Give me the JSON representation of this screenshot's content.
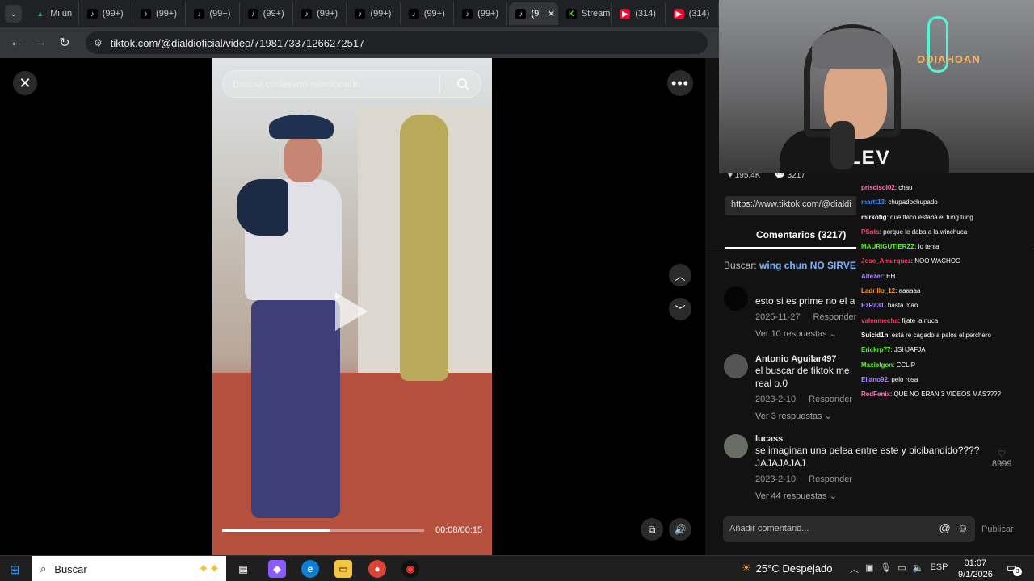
{
  "browser": {
    "tabs": [
      {
        "label": "Mi un",
        "icon": "drive-icon"
      },
      {
        "label": "(99+)",
        "icon": "tiktok-icon"
      },
      {
        "label": "(99+)",
        "icon": "tiktok-icon"
      },
      {
        "label": "(99+)",
        "icon": "tiktok-icon"
      },
      {
        "label": "(99+)",
        "icon": "tiktok-icon"
      },
      {
        "label": "(99+)",
        "icon": "tiktok-icon"
      },
      {
        "label": "(99+)",
        "icon": "tiktok-icon"
      },
      {
        "label": "(99+)",
        "icon": "tiktok-icon"
      },
      {
        "label": "(99+)",
        "icon": "tiktok-icon"
      },
      {
        "label": "(9",
        "icon": "tiktok-icon",
        "active": true
      },
      {
        "label": "Stream",
        "icon": "kick-icon"
      },
      {
        "label": "(314)",
        "icon": "youtube-icon"
      },
      {
        "label": "(314)",
        "icon": "youtube-icon"
      }
    ],
    "url": "tiktok.com/@dialdioficial/video/7198173371266272517"
  },
  "video": {
    "search_placeholder": "Buscar contenido relacionado",
    "time": "00:08/00:15",
    "progress": 0.53
  },
  "panel": {
    "likes": "195.4K",
    "comments_count": "3217",
    "share_url": "https://www.tiktok.com/@dialdi",
    "comments_tab": "Comentarios (3217)",
    "search_label": "Buscar:",
    "search_query": "wing chun NO SIRVE",
    "comments": [
      {
        "user": "",
        "text": "esto si es prime no el a",
        "date": "2025-11-27",
        "reply": "Responder",
        "replies": "Ver 10 respuestas ⌄"
      },
      {
        "user": "Antonio Aguilar497",
        "text": "el buscar de tiktok me real o.0",
        "date": "2023-2-10",
        "reply": "Responder",
        "replies": "Ver 3 respuestas ⌄"
      },
      {
        "user": "lucass",
        "text": "se imaginan una pelea entre este y bicibandido???? JAJAJAJAJ",
        "date": "2023-2-10",
        "reply": "Responder",
        "replies": "Ver 44 respuestas ⌄",
        "likes": "8999"
      }
    ],
    "compose_placeholder": "Añadir comentario...",
    "publish": "Publicar"
  },
  "cam": {
    "neon_text": "ODIAHOAN",
    "shirt_text": "LEV"
  },
  "chat": [
    {
      "user": "priscisol02",
      "msg": ": chau",
      "color": "#ff7ab5"
    },
    {
      "user": "martt13",
      "msg": ": chupadochupado",
      "color": "#3d8cff"
    },
    {
      "user": "mirkofig",
      "msg": ": que flaco estaba el tung tung",
      "color": "#ffffff"
    },
    {
      "user": "PSnts",
      "msg": ": porque le daba a la winchuca",
      "color": "#ff3b6b"
    },
    {
      "user": "MAURIGUTIERZZ",
      "msg": ": lo tenia",
      "color": "#53fc18"
    },
    {
      "user": "Jose_Amurquez",
      "msg": ": NOO WACHOO",
      "color": "#ff3b6b"
    },
    {
      "user": "Altezer",
      "msg": ": EH",
      "color": "#b38cff"
    },
    {
      "user": "Ladrillo_12",
      "msg": ": aaaaaa",
      "color": "#ff9d2e"
    },
    {
      "user": "EzRa31",
      "msg": ": basta man",
      "color": "#b38cff"
    },
    {
      "user": "valenmecha",
      "msg": ": fijate la nuca",
      "color": "#ff3b6b"
    },
    {
      "user": "Suicid1n",
      "msg": ": está re cagado a palos el perchero",
      "color": "#ffffff"
    },
    {
      "user": "Erickrp77",
      "msg": ": JSHJAFJA",
      "color": "#53fc18"
    },
    {
      "user": "Maxielgon",
      "msg": ": CCLIP",
      "color": "#53fc18"
    },
    {
      "user": "Eliano92",
      "msg": ": pelo rosa",
      "color": "#b38cff"
    },
    {
      "user": "RedFenix",
      "msg": ": QUE NO ERAN 3 VIDEOS MÁS????",
      "color": "#ff7ab5"
    }
  ],
  "taskbar": {
    "search": "Buscar",
    "weather": "25°C  Despejado",
    "lang": "ESP",
    "time": "01:07",
    "date": "9/1/2026",
    "notifications": "3"
  }
}
